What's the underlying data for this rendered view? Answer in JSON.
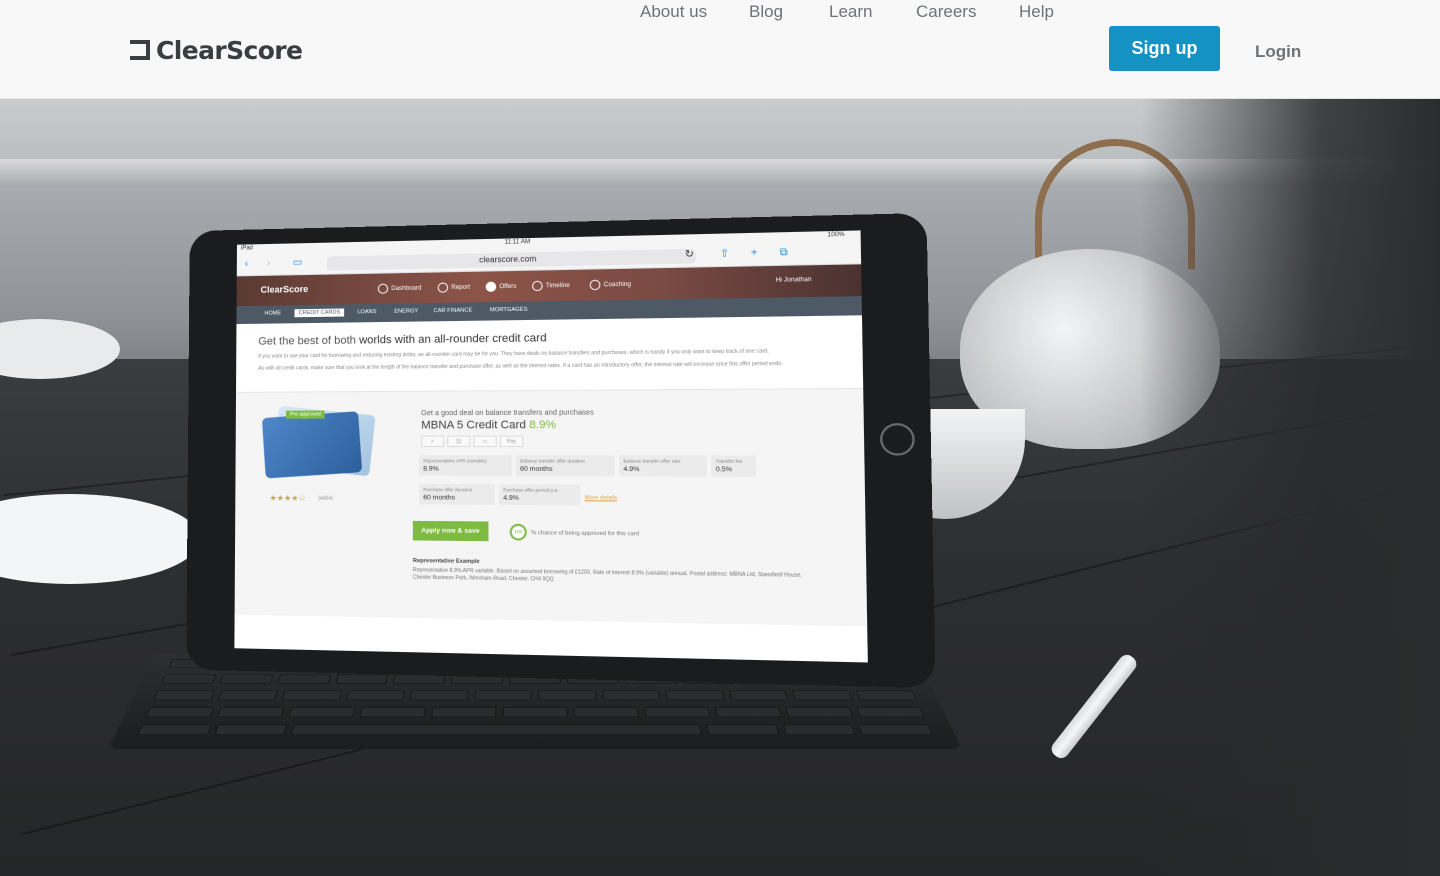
{
  "header": {
    "brand": "ClearScore",
    "nav": [
      "About us",
      "Blog",
      "Learn",
      "Careers",
      "Help"
    ],
    "signup_label": "Sign up",
    "login_label": "Login",
    "signup_color": "#1592c4"
  },
  "tablet_screen": {
    "status": {
      "device": "iPad",
      "time": "11:11 AM",
      "battery": "100%"
    },
    "url": "clearscore.com",
    "site_brand": "ClearScore",
    "tabs": [
      "Dashboard",
      "Report",
      "Offers",
      "Timeline",
      "Coaching"
    ],
    "greeting": "Hi Jonathan",
    "subnav": [
      "HOME",
      "CREDIT CARDS",
      "LOANS",
      "ENERGY",
      "CAR FINANCE",
      "MORTGAGES"
    ],
    "headline_prefix": "Get the best of both",
    "headline_suffix": "worlds with an all-rounder credit card",
    "para1": "If you want to use your card for borrowing and reducing existing debts, an all-rounder card may be for you. They have deals on balance transfers and purchases, which is handy if you only want to keep track of one card.",
    "para2": "As with all credit cards, make sure that you look at the length of the balance transfer and purchase offer, as well as the interest rates. If a card has an introductory offer, the interest rate will increase once this offer period ends.",
    "offer": {
      "badge": "Pre-approved",
      "rating_count": "(4464)",
      "subtitle": "Get a good deal on balance transfers and purchases",
      "title": "MBNA 5 Credit Card",
      "rate": "8.9%",
      "stats": [
        {
          "label": "Representative APR (variable)",
          "value": "8.9%"
        },
        {
          "label": "Balance transfer offer duration",
          "value": "60 months"
        },
        {
          "label": "Balance transfer offer rate",
          "value": "4.9%"
        },
        {
          "label": "Transfer fee",
          "value": "0.5%"
        },
        {
          "label": "Purchase offer duration",
          "value": "60 months"
        },
        {
          "label": "Purchase offer period p.a.",
          "value": "4.9%"
        }
      ],
      "more_details": "More details",
      "apply_label": "Apply now & save",
      "chance_value": "100",
      "chance_text": "% chance of being approved for this card",
      "rep_title": "Representative Example",
      "rep_text": "Representative 8.9% APR variable. Based on assumed borrowing of £1200. Rate of interest 8.9% (variable) annual. Postal address: MBNA Ltd, Stansfield House, Chester Business Park, Wrexham Road, Chester, CH4 9QQ"
    }
  }
}
